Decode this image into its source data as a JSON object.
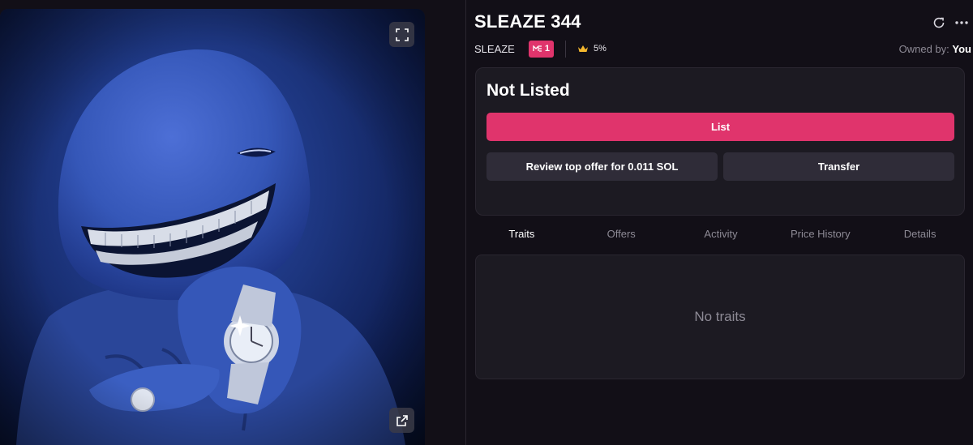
{
  "item": {
    "title": "SLEAZE 344",
    "collection": "SLEAZE",
    "me_rank": "1",
    "royalty": "5%",
    "owned_by_label": "Owned by:",
    "owner": "You"
  },
  "listing": {
    "status": "Not Listed",
    "list_label": "List",
    "offer_label": "Review top offer for 0.011 SOL",
    "transfer_label": "Transfer"
  },
  "tabs": [
    {
      "label": "Traits",
      "active": true
    },
    {
      "label": "Offers",
      "active": false
    },
    {
      "label": "Activity",
      "active": false
    },
    {
      "label": "Price History",
      "active": false
    },
    {
      "label": "Details",
      "active": false
    }
  ],
  "traits": {
    "empty_message": "No traits"
  },
  "icons": {
    "fullscreen": "fullscreen-icon",
    "external": "external-link-icon",
    "refresh": "refresh-icon",
    "more": "more-icon",
    "crown": "crown-icon",
    "me_logo": "magic-eden-logo"
  },
  "colors": {
    "background": "#120f17",
    "card": "#1c1a22",
    "accent": "#e0346c",
    "secondary_button": "#2f2c38",
    "muted_text": "#8d8a95",
    "crown": "#f5b82e"
  }
}
